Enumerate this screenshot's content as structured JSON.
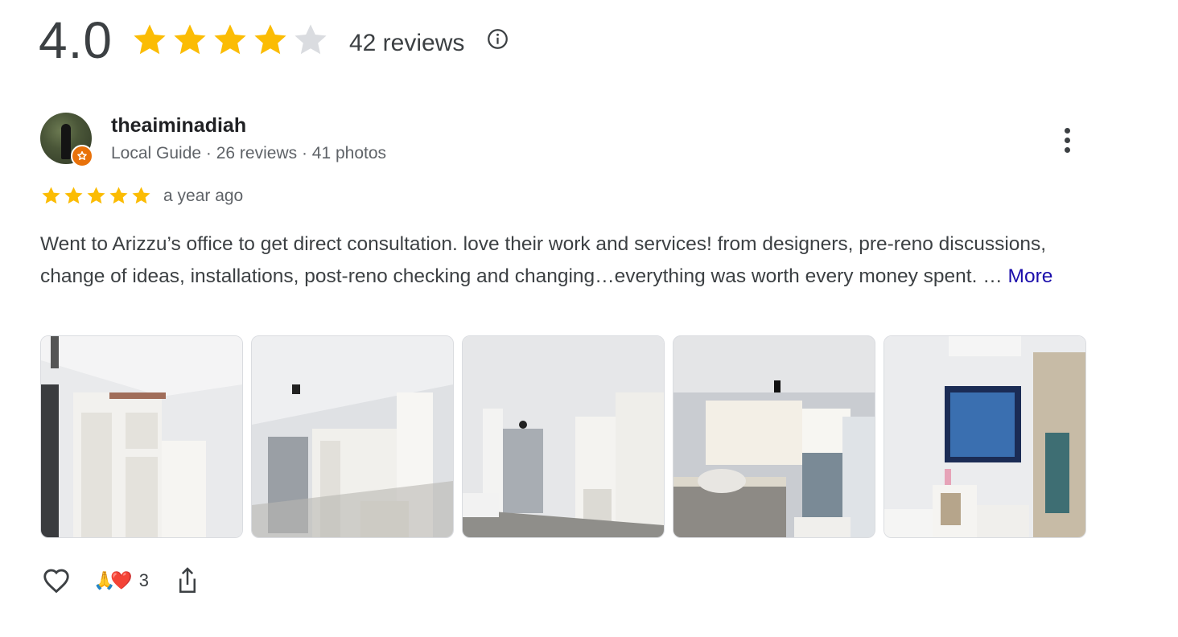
{
  "summary": {
    "rating": "4.0",
    "rating_value": 4.0,
    "rating_max": 5,
    "review_count_label": "42 reviews",
    "info_icon": "info-icon"
  },
  "review": {
    "author": "theaiminadiah",
    "author_meta": "Local Guide · 26 reviews · 41 photos",
    "badge_icon": "local-guide-star-icon",
    "rating_value": 5,
    "rating_max": 5,
    "time": "a year ago",
    "text": "Went to Arizzu’s office to get direct consultation. love their work and services! from designers, pre-reno discussions, change of ideas, installations, post-reno checking and changing…everything was worth every money spent. … ",
    "more_label": "More",
    "menu_icon": "more-vert-icon",
    "photos_count": 5
  },
  "actions": {
    "like_icon": "heart-outline-icon",
    "reaction_emojis": "🙏❤️",
    "reaction_count": "3",
    "share_icon": "share-icon"
  },
  "colors": {
    "star_filled": "#fbbc04",
    "star_empty": "#dadce0",
    "link": "#1a0dab",
    "local_guide_badge": "#e8710a"
  }
}
